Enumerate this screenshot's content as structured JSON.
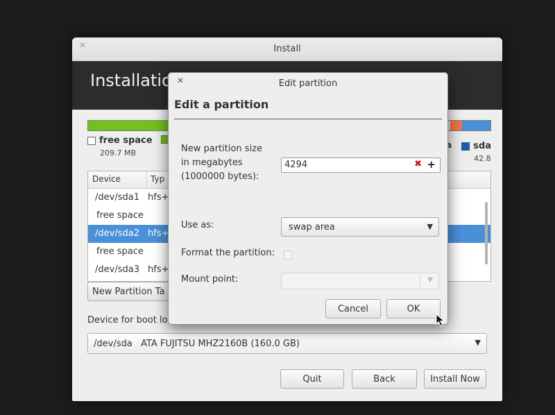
{
  "main_window": {
    "title": "Install",
    "heading": "Installation",
    "partition_bar_colors": [
      "#73c11b",
      "#f07746",
      "#4a90d9"
    ],
    "legend_free": {
      "label": "free space",
      "size": "209.7 MB"
    },
    "legend_sda": {
      "label": "sda",
      "size": "42.8"
    },
    "legend_partial": "a",
    "table": {
      "columns": [
        "Device",
        "Typ"
      ],
      "rows": [
        {
          "device": "/dev/sda1",
          "type": "hfs+"
        },
        {
          "device": "free space",
          "type": ""
        },
        {
          "device": "/dev/sda2",
          "type": "hfs+",
          "selected": true
        },
        {
          "device": "free space",
          "type": ""
        },
        {
          "device": "/dev/sda3",
          "type": "hfs+"
        }
      ]
    },
    "new_partition_table_label": "New Partition Ta",
    "boot_loader_label": "Device for boot lo",
    "boot_device_value": "/dev/sda   ATA FUJITSU MHZ2160B (160.0 GB)",
    "buttons": {
      "quit": "Quit",
      "back": "Back",
      "install_now": "Install Now"
    }
  },
  "dialog": {
    "title": "Edit partition",
    "heading": "Edit a partition",
    "size_label_1": "New partition size",
    "size_label_2": "in megabytes",
    "size_label_3": "(1000000 bytes):",
    "size_value": "4294",
    "use_as_label": "Use as:",
    "use_as_value": "swap area",
    "format_label": "Format the partition:",
    "format_checked": false,
    "mount_label": "Mount point:",
    "mount_value": "",
    "cancel_label": "Cancel",
    "ok_label": "OK"
  }
}
